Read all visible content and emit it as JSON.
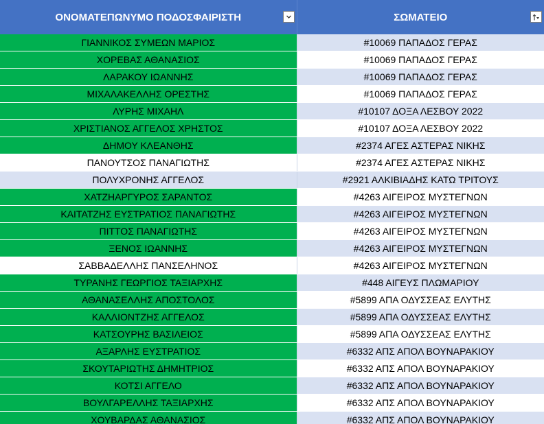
{
  "headers": {
    "player": "ΟΝΟΜΑΤΕΠΩΝΥΜΟ ΠΟΔΟΣΦΑΙΡΙΣΤΗ",
    "club": "ΣΩΜΑΤΕΙΟ"
  },
  "filter_icons": {
    "player": "dropdown-arrow-icon",
    "club": "sort-ascending-filter-icon"
  },
  "colors": {
    "header_bg": "#4472c4",
    "highlight_green": "#00b050",
    "band_blue": "#d9e1f2"
  },
  "rows": [
    {
      "player": "ΓΙΑΝΝΙΚΟΣ ΣΥΜΕΩΝ ΜΑΡΙΟΣ",
      "club": "#10069 ΠΑΠΑΔΟΣ ΓΕΡΑΣ",
      "highlight": "green"
    },
    {
      "player": "ΧΟΡΕΒΑΣ ΑΘΑΝΑΣΙΟΣ",
      "club": "#10069 ΠΑΠΑΔΟΣ ΓΕΡΑΣ",
      "highlight": "green"
    },
    {
      "player": "ΛΑΡΑΚΟΥ ΙΩΑΝΝΗΣ",
      "club": "#10069 ΠΑΠΑΔΟΣ ΓΕΡΑΣ",
      "highlight": "green"
    },
    {
      "player": "ΜΙΧΑΛΑΚΕΛΛΗΣ ΟΡΕΣΤΗΣ",
      "club": "#10069 ΠΑΠΑΔΟΣ ΓΕΡΑΣ",
      "highlight": "green"
    },
    {
      "player": "ΛΥΡΗΣ ΜΙΧΑΗΛ",
      "club": "#10107 ΔΟΞΑ ΛΕΣΒΟΥ 2022",
      "highlight": "green"
    },
    {
      "player": "ΧΡΙΣΤΙΑΝΟΣ ΑΓΓΕΛΟΣ ΧΡΗΣΤΟΣ",
      "club": "#10107 ΔΟΞΑ ΛΕΣΒΟΥ 2022",
      "highlight": "green"
    },
    {
      "player": "ΔΗΜΟΥ ΚΛΕΑΝΘΗΣ",
      "club": "#2374 ΑΓΕΣ ΑΣΤΕΡΑΣ ΝΙΚΗΣ",
      "highlight": "green"
    },
    {
      "player": "ΠΑΝΟΥΤΣΟΣ ΠΑΝΑΓΙΩΤΗΣ",
      "club": "#2374 ΑΓΕΣ ΑΣΤΕΡΑΣ ΝΙΚΗΣ",
      "highlight": "none"
    },
    {
      "player": "ΠΟΛΥΧΡΟΝΗΣ ΑΓΓΕΛΟΣ",
      "club": "#2921 ΑΛΚΙΒΙΑΔΗΣ ΚΑΤΩ ΤΡΙΤΟΥΣ",
      "highlight": "none"
    },
    {
      "player": "ΧΑΤΖΗΑΡΓΥΡΟΣ ΣΑΡΑΝΤΟΣ",
      "club": "#4263 ΑΙΓΕΙΡΟΣ ΜΥΣΤΕΓΝΩΝ",
      "highlight": "green"
    },
    {
      "player": "ΚΑΙΤΑΤΖΗΣ ΕΥΣΤΡΑΤΙΟΣ ΠΑΝΑΓΙΩΤΗΣ",
      "club": "#4263 ΑΙΓΕΙΡΟΣ ΜΥΣΤΕΓΝΩΝ",
      "highlight": "green"
    },
    {
      "player": "ΠΙΤΤΟΣ ΠΑΝΑΓΙΩΤΗΣ",
      "club": "#4263 ΑΙΓΕΙΡΟΣ ΜΥΣΤΕΓΝΩΝ",
      "highlight": "green"
    },
    {
      "player": "ΞΕΝΟΣ ΙΩΑΝΝΗΣ",
      "club": "#4263 ΑΙΓΕΙΡΟΣ ΜΥΣΤΕΓΝΩΝ",
      "highlight": "green"
    },
    {
      "player": "ΣΑΒΒΑΔΕΛΛΗΣ ΠΑΝΣΕΛΗΝΟΣ",
      "club": "#4263 ΑΙΓΕΙΡΟΣ ΜΥΣΤΕΓΝΩΝ",
      "highlight": "none"
    },
    {
      "player": "ΤΥΡΑΝΗΣ ΓΕΩΡΓΙΟΣ ΤΑΞΙΑΡΧΗΣ",
      "club": "#448 ΑΙΓΕΥΣ ΠΛΩΜΑΡΙΟΥ",
      "highlight": "green"
    },
    {
      "player": "ΑΘΑΝΑΣΕΛΛΗΣ ΑΠΟΣΤΟΛΟΣ",
      "club": "#5899 ΑΠΑ ΟΔΥΣΣΕΑΣ ΕΛΥΤΗΣ",
      "highlight": "green"
    },
    {
      "player": "ΚΑΛΛΙΟΝΤΖΗΣ ΑΓΓΕΛΟΣ",
      "club": "#5899 ΑΠΑ ΟΔΥΣΣΕΑΣ ΕΛΥΤΗΣ",
      "highlight": "green"
    },
    {
      "player": "ΚΑΤΣΟΥΡΗΣ ΒΑΣΙΛΕΙΟΣ",
      "club": "#5899 ΑΠΑ ΟΔΥΣΣΕΑΣ ΕΛΥΤΗΣ",
      "highlight": "green"
    },
    {
      "player": "ΑΞΑΡΛΗΣ ΕΥΣΤΡΑΤΙΟΣ",
      "club": "#6332 ΑΠΣ ΑΠΟΛ ΒΟΥΝΑΡΑΚΙΟΥ",
      "highlight": "green"
    },
    {
      "player": "ΣΚΟΥΤΑΡΙΩΤΗΣ ΔΗΜΗΤΡΙΟΣ",
      "club": "#6332 ΑΠΣ ΑΠΟΛ ΒΟΥΝΑΡΑΚΙΟΥ",
      "highlight": "green"
    },
    {
      "player": "ΚΟΤΣΙ ΑΓΓΕΛΟ",
      "club": "#6332 ΑΠΣ ΑΠΟΛ ΒΟΥΝΑΡΑΚΙΟΥ",
      "highlight": "green"
    },
    {
      "player": "ΒΟΥΛΓΑΡΕΛΛΗΣ ΤΑΞΙΑΡΧΗΣ",
      "club": "#6332 ΑΠΣ ΑΠΟΛ ΒΟΥΝΑΡΑΚΙΟΥ",
      "highlight": "green"
    },
    {
      "player": "ΧΟΥΒΑΡΔΑΣ ΑΘΑΝΑΣΙΟΣ",
      "club": "#6332 ΑΠΣ ΑΠΟΛ ΒΟΥΝΑΡΑΚΙΟΥ",
      "highlight": "green"
    }
  ]
}
